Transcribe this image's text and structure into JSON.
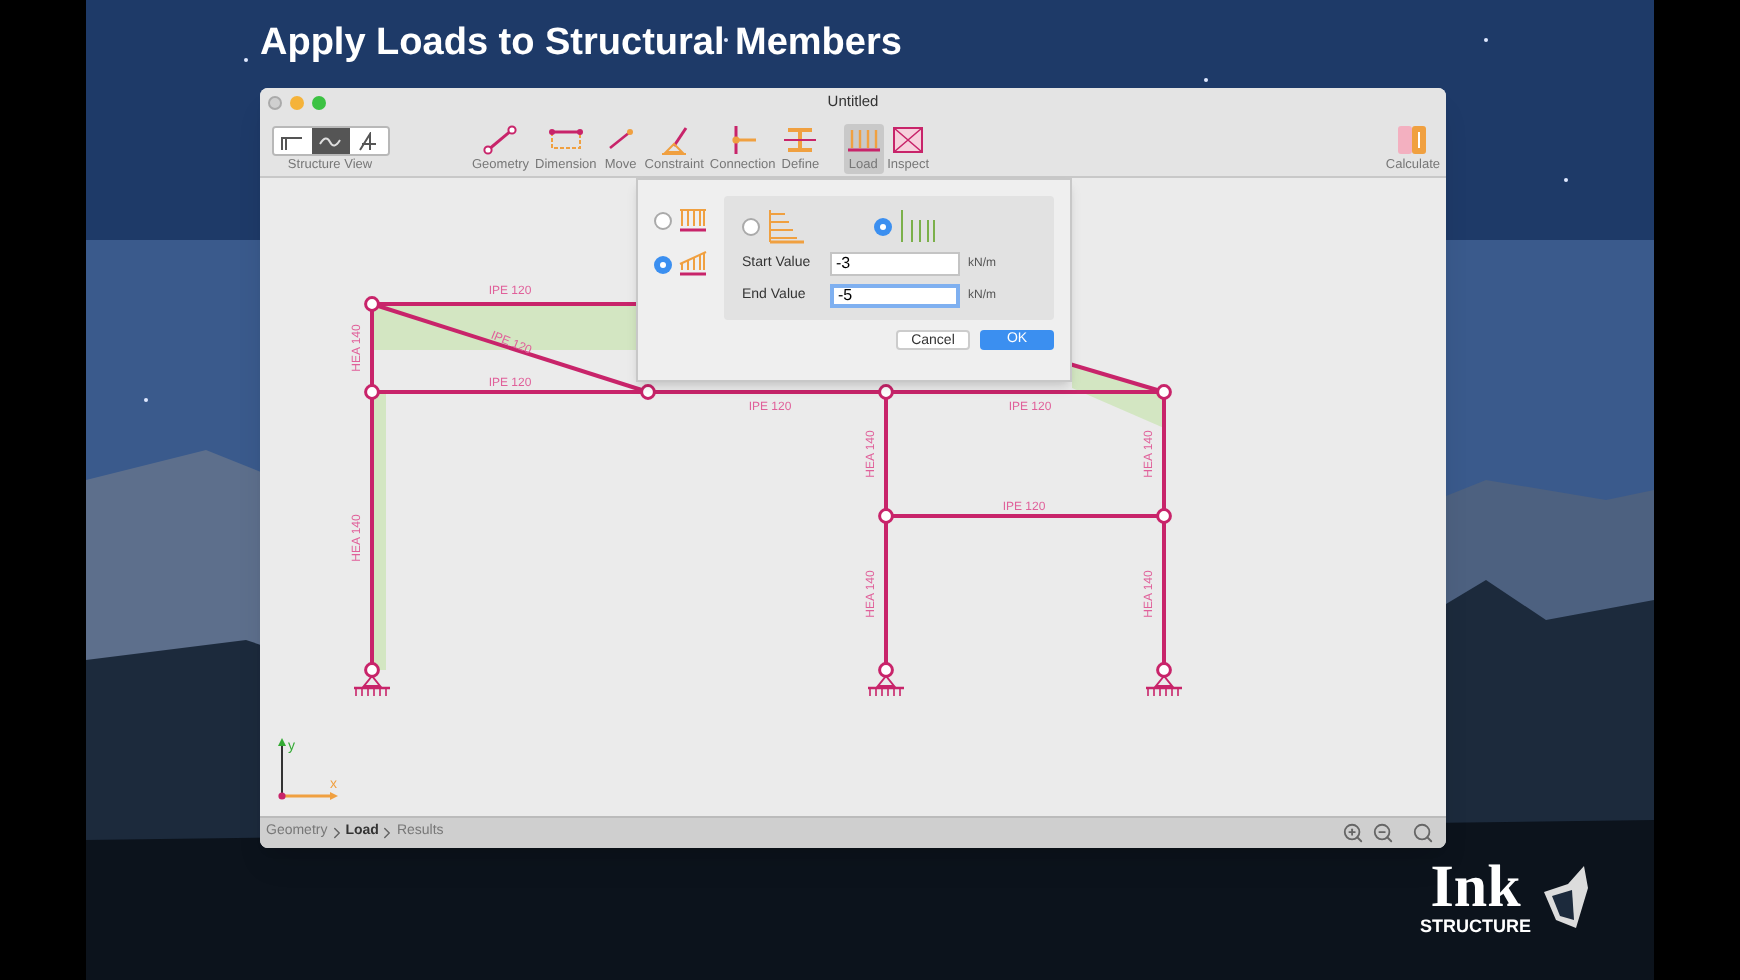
{
  "headline": "Apply Loads to Structural Members",
  "window": {
    "title": "Untitled"
  },
  "toolbar": {
    "view_label": "Structure View",
    "view_segments": [
      {
        "selected": false
      },
      {
        "selected": true
      },
      {
        "selected": false
      }
    ],
    "tools": [
      {
        "label": "Geometry",
        "selected": false
      },
      {
        "label": "Dimension",
        "selected": false
      },
      {
        "label": "Move",
        "selected": false
      },
      {
        "label": "Constraint",
        "selected": false
      },
      {
        "label": "Connection",
        "selected": false
      },
      {
        "label": "Define",
        "selected": false
      },
      {
        "label": "Load",
        "selected": true
      },
      {
        "label": "Inspect",
        "selected": false
      }
    ],
    "calculate": "Calculate"
  },
  "drawing": {
    "member_labels": [
      "IPE 120",
      "IPE 120",
      "IPE 120",
      "IPE 120",
      "IPE 120",
      "HEA 140",
      "HEA 140",
      "HEA 140",
      "HEA 140",
      "IPE 120",
      "HEA 140",
      "HEA 140"
    ],
    "axes": {
      "y": "y",
      "x": "x"
    }
  },
  "load_dialog": {
    "distribution": [
      {
        "selected": false
      },
      {
        "selected": true
      }
    ],
    "direction": [
      {
        "selected": false
      },
      {
        "selected": true
      }
    ],
    "fields": [
      {
        "label": "Start Value",
        "value": "-3",
        "unit": "kN/m",
        "focused": false
      },
      {
        "label": "End Value",
        "value": "-5",
        "unit": "kN/m",
        "focused": true
      }
    ],
    "buttons": [
      "Cancel",
      "OK"
    ]
  },
  "breadcrumb": [
    {
      "label": "Geometry",
      "selected": false
    },
    {
      "label": "Load",
      "selected": true
    },
    {
      "label": "Results",
      "selected": false
    }
  ],
  "logo": {
    "name": "Ink",
    "tagline": "STRUCTURE"
  }
}
